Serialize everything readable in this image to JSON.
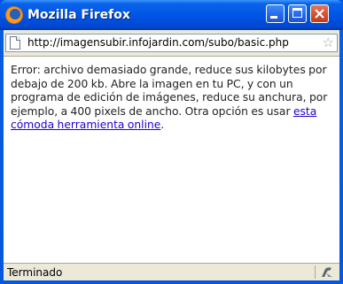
{
  "window": {
    "title": "Mozilla Firefox",
    "buttons": {
      "minimize": "minimize-icon",
      "maximize": "maximize-icon",
      "close": "close-icon"
    }
  },
  "address_bar": {
    "url": "http://imagensubir.infojardin.com/subo/basic.php",
    "page_icon": "page-icon",
    "bookmark_icon": "star-icon"
  },
  "content": {
    "message_before_link": "Error: archivo demasiado grande, reduce sus kilobytes por debajo de 200 kb. Abre la imagen en tu PC, y con un programa de edición de imágenes, reduce su anchura, por ejemplo, a 400 pixels de ancho. Otra opción es usar ",
    "link_text": "esta cómoda herramienta online",
    "message_after_link": "."
  },
  "status_bar": {
    "text": "Terminado",
    "icon": "security-icon"
  },
  "colors": {
    "titlebar": "#0055e5",
    "close_button": "#d34d2b",
    "chrome": "#ece9d8",
    "link": "#2200cc"
  }
}
